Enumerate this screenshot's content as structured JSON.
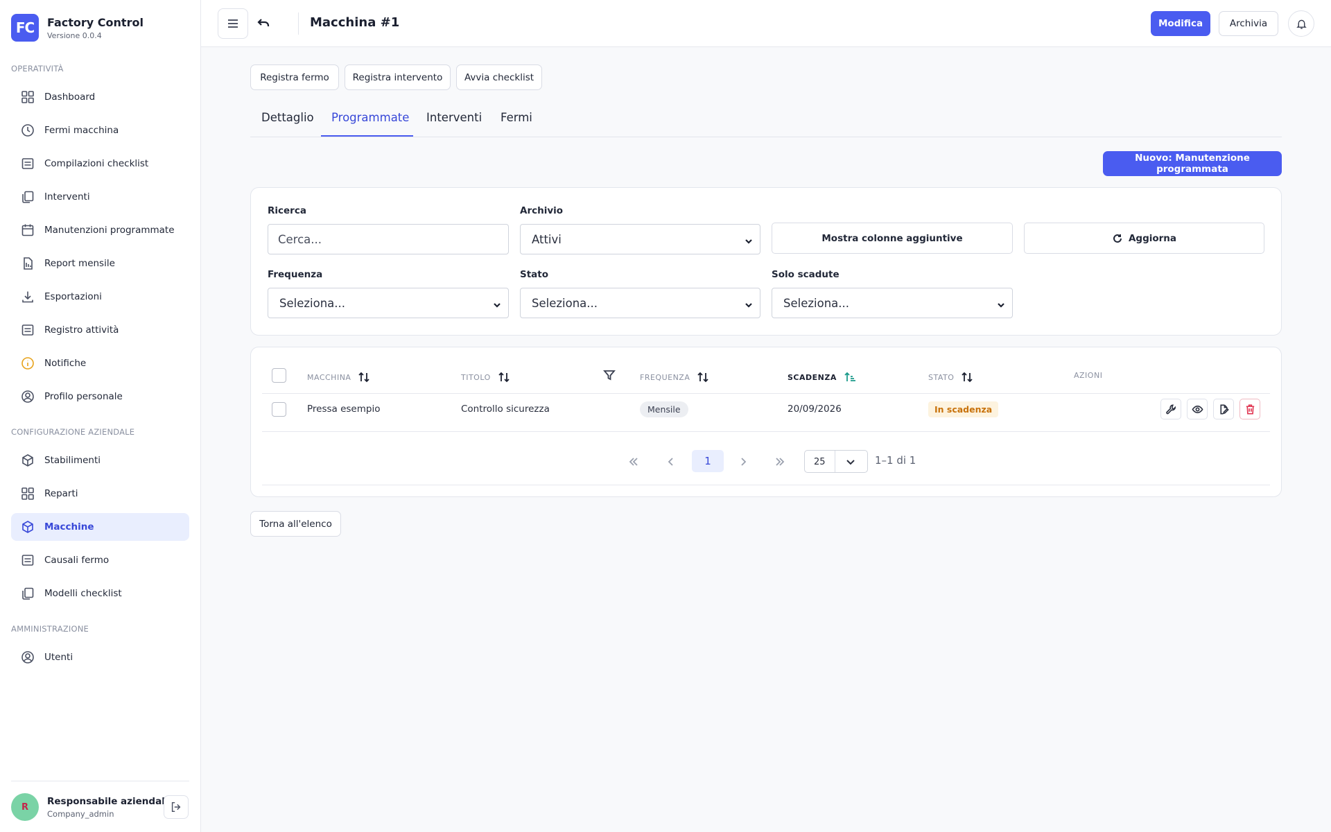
{
  "app": {
    "logo": "FC",
    "name": "Factory Control",
    "version": "Versione 0.0.4"
  },
  "sidebar": {
    "sections": [
      {
        "label": "OPERATIVITÀ"
      },
      {
        "label": "CONFIGURAZIONE AZIENDALE"
      },
      {
        "label": "AMMINISTRAZIONE"
      }
    ],
    "items": [
      {
        "label": "Dashboard",
        "icon": "grid-icon"
      },
      {
        "label": "Fermi macchina",
        "icon": "clock-icon"
      },
      {
        "label": "Compilazioni checklist",
        "icon": "list-icon"
      },
      {
        "label": "Interventi",
        "icon": "copy-icon"
      },
      {
        "label": "Manutenzioni programmate",
        "icon": "calendar-icon"
      },
      {
        "label": "Report mensile",
        "icon": "report-icon"
      },
      {
        "label": "Esportazioni",
        "icon": "download-icon"
      },
      {
        "label": "Registro attività",
        "icon": "list-icon"
      },
      {
        "label": "Notifiche",
        "icon": "info-icon"
      },
      {
        "label": "Profilo personale",
        "icon": "user-icon"
      },
      {
        "label": "Stabilimenti",
        "icon": "cube-icon"
      },
      {
        "label": "Reparti",
        "icon": "grid-icon"
      },
      {
        "label": "Macchine",
        "icon": "cube-icon",
        "active": true
      },
      {
        "label": "Causali fermo",
        "icon": "list-icon"
      },
      {
        "label": "Modelli checklist",
        "icon": "copy-icon"
      },
      {
        "label": "Utenti",
        "icon": "user-icon"
      }
    ]
  },
  "user": {
    "initial": "R",
    "name": "Responsabile aziendale",
    "role": "Company_admin"
  },
  "header": {
    "title": "Macchina #1",
    "edit_label": "Modifica",
    "archive_label": "Archivia"
  },
  "actions": {
    "register_stop": "Registra fermo",
    "register_intervention": "Registra intervento",
    "start_checklist": "Avvia checklist"
  },
  "tabs": [
    {
      "label": "Dettaglio"
    },
    {
      "label": "Programmate",
      "active": true
    },
    {
      "label": "Interventi"
    },
    {
      "label": "Fermi"
    }
  ],
  "new_button": "Nuovo: Manutenzione programmata",
  "filters": {
    "search_label": "Ricerca",
    "search_placeholder": "Cerca...",
    "archive_label": "Archivio",
    "archive_value": "Attivi",
    "more_columns": "Mostra colonne aggiuntive",
    "refresh": "Aggiorna",
    "frequency_label": "Frequenza",
    "frequency_value": "Seleziona...",
    "status_label": "Stato",
    "status_value": "Seleziona...",
    "overdue_label": "Solo scadute",
    "overdue_value": "Seleziona..."
  },
  "table": {
    "columns": [
      "MACCHINA",
      "TITOLO",
      "FREQUENZA",
      "SCADENZA",
      "STATO",
      "AZIONI"
    ],
    "sorted_column": "SCADENZA",
    "rows": [
      {
        "machine": "Pressa esempio",
        "title": "Controllo sicurezza",
        "frequency": "Mensile",
        "due": "20/09/2026",
        "status": "In scadenza"
      }
    ]
  },
  "pagination": {
    "current_page": "1",
    "per_page": "25",
    "range": "1–1 di 1"
  },
  "back_button": "Torna all'elenco",
  "colors": {
    "accent": "#4a5cf0",
    "active_bg": "#e9eefe",
    "warning": "#c8720b",
    "danger": "#e0334f"
  }
}
